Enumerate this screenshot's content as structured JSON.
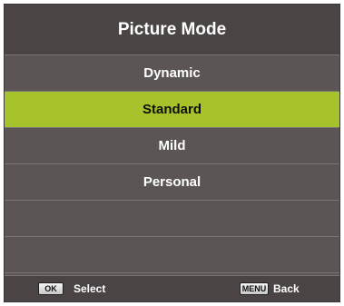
{
  "menu": {
    "title": "Picture Mode",
    "items": [
      {
        "label": "Dynamic",
        "selected": false
      },
      {
        "label": "Standard",
        "selected": true
      },
      {
        "label": "Mild",
        "selected": false
      },
      {
        "label": "Personal",
        "selected": false
      },
      {
        "label": "",
        "selected": false
      },
      {
        "label": "",
        "selected": false
      }
    ]
  },
  "footer": {
    "ok_key": "OK",
    "ok_label": "Select",
    "menu_key": "MENU",
    "menu_label": "Back"
  },
  "colors": {
    "highlight": "#a6c32b",
    "panel": "#5b5655",
    "header": "#4a4544"
  }
}
